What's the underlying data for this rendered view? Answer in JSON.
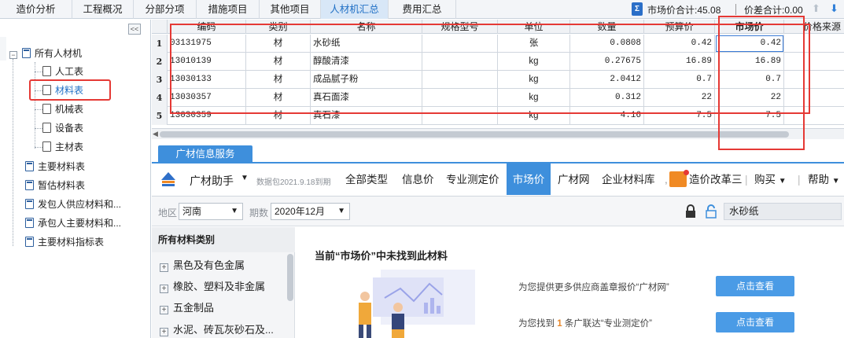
{
  "tabs": [
    "造价分析",
    "工程概况",
    "分部分项",
    "措施项目",
    "其他项目",
    "人材机汇总",
    "费用汇总"
  ],
  "summary": {
    "market_total": "市场价合计:45.08",
    "diff_total": "价差合计:0.00",
    "icon_glyph": "Σ"
  },
  "tree": {
    "collapse_glyph": "<<",
    "root": "所有人材机",
    "children": [
      "人工表",
      "材料表",
      "机械表",
      "设备表",
      "主材表"
    ],
    "others": [
      "主要材料表",
      "暂估材料表",
      "发包人供应材料和...",
      "承包人主要材料和...",
      "主要材料指标表"
    ],
    "selected": "材料表"
  },
  "grid": {
    "headers": [
      "编码",
      "类别",
      "名称",
      "规格型号",
      "单位",
      "数量",
      "预算价",
      "市场价",
      "价格来源"
    ],
    "rows": [
      {
        "n": "1",
        "code": "03131975",
        "cat": "材",
        "name": "水砂纸",
        "spec": "",
        "unit": "张",
        "qty": "0.0808",
        "budget": "0.42",
        "market": "0.42",
        "src": ""
      },
      {
        "n": "2",
        "code": "13010139",
        "cat": "材",
        "name": "醇酸清漆",
        "spec": "",
        "unit": "kg",
        "qty": "0.27675",
        "budget": "16.89",
        "market": "16.89",
        "src": ""
      },
      {
        "n": "3",
        "code": "13030133",
        "cat": "材",
        "name": "成品腻子粉",
        "spec": "",
        "unit": "kg",
        "qty": "2.0412",
        "budget": "0.7",
        "market": "0.7",
        "src": ""
      },
      {
        "n": "4",
        "code": "13030357",
        "cat": "材",
        "name": "真石面漆",
        "spec": "",
        "unit": "kg",
        "qty": "0.312",
        "budget": "22",
        "market": "22",
        "src": ""
      },
      {
        "n": "5",
        "code": "13030359",
        "cat": "材",
        "name": "真石漆",
        "spec": "",
        "unit": "kg",
        "qty": "4.16",
        "budget": "7.5",
        "market": "7.5",
        "src": ""
      }
    ]
  },
  "service_tab": "广材信息服务",
  "gcz": {
    "helper": "广材助手",
    "data_package": "数据包2021.9.18到期",
    "nav": [
      "全部类型",
      "信息价",
      "专业测定价",
      "市场价",
      "广材网",
      "企业材料库",
      "造价改革三"
    ],
    "active_nav": "市场价",
    "buy": "购买",
    "help": "帮助"
  },
  "filter": {
    "region_label": "地区",
    "region": "河南",
    "period_label": "期数",
    "period": "2020年12月",
    "search": "水砂纸"
  },
  "categories": {
    "title": "所有材料类别",
    "items": [
      "黑色及有色金属",
      "橡胶、塑料及非金属",
      "五金制品",
      "水泥、砖瓦灰砂石及..."
    ]
  },
  "result": {
    "not_found": "当前“市场价”中未找到此材料",
    "line1": "为您提供更多供应商盖章报价“广材网”",
    "line2_pre": "为您找到",
    "line2_count": "1",
    "line2_post": "条广联达“专业测定价”",
    "button": "点击查看"
  },
  "colors": {
    "accent": "#3e8fdc",
    "highlight": "#e53935"
  }
}
